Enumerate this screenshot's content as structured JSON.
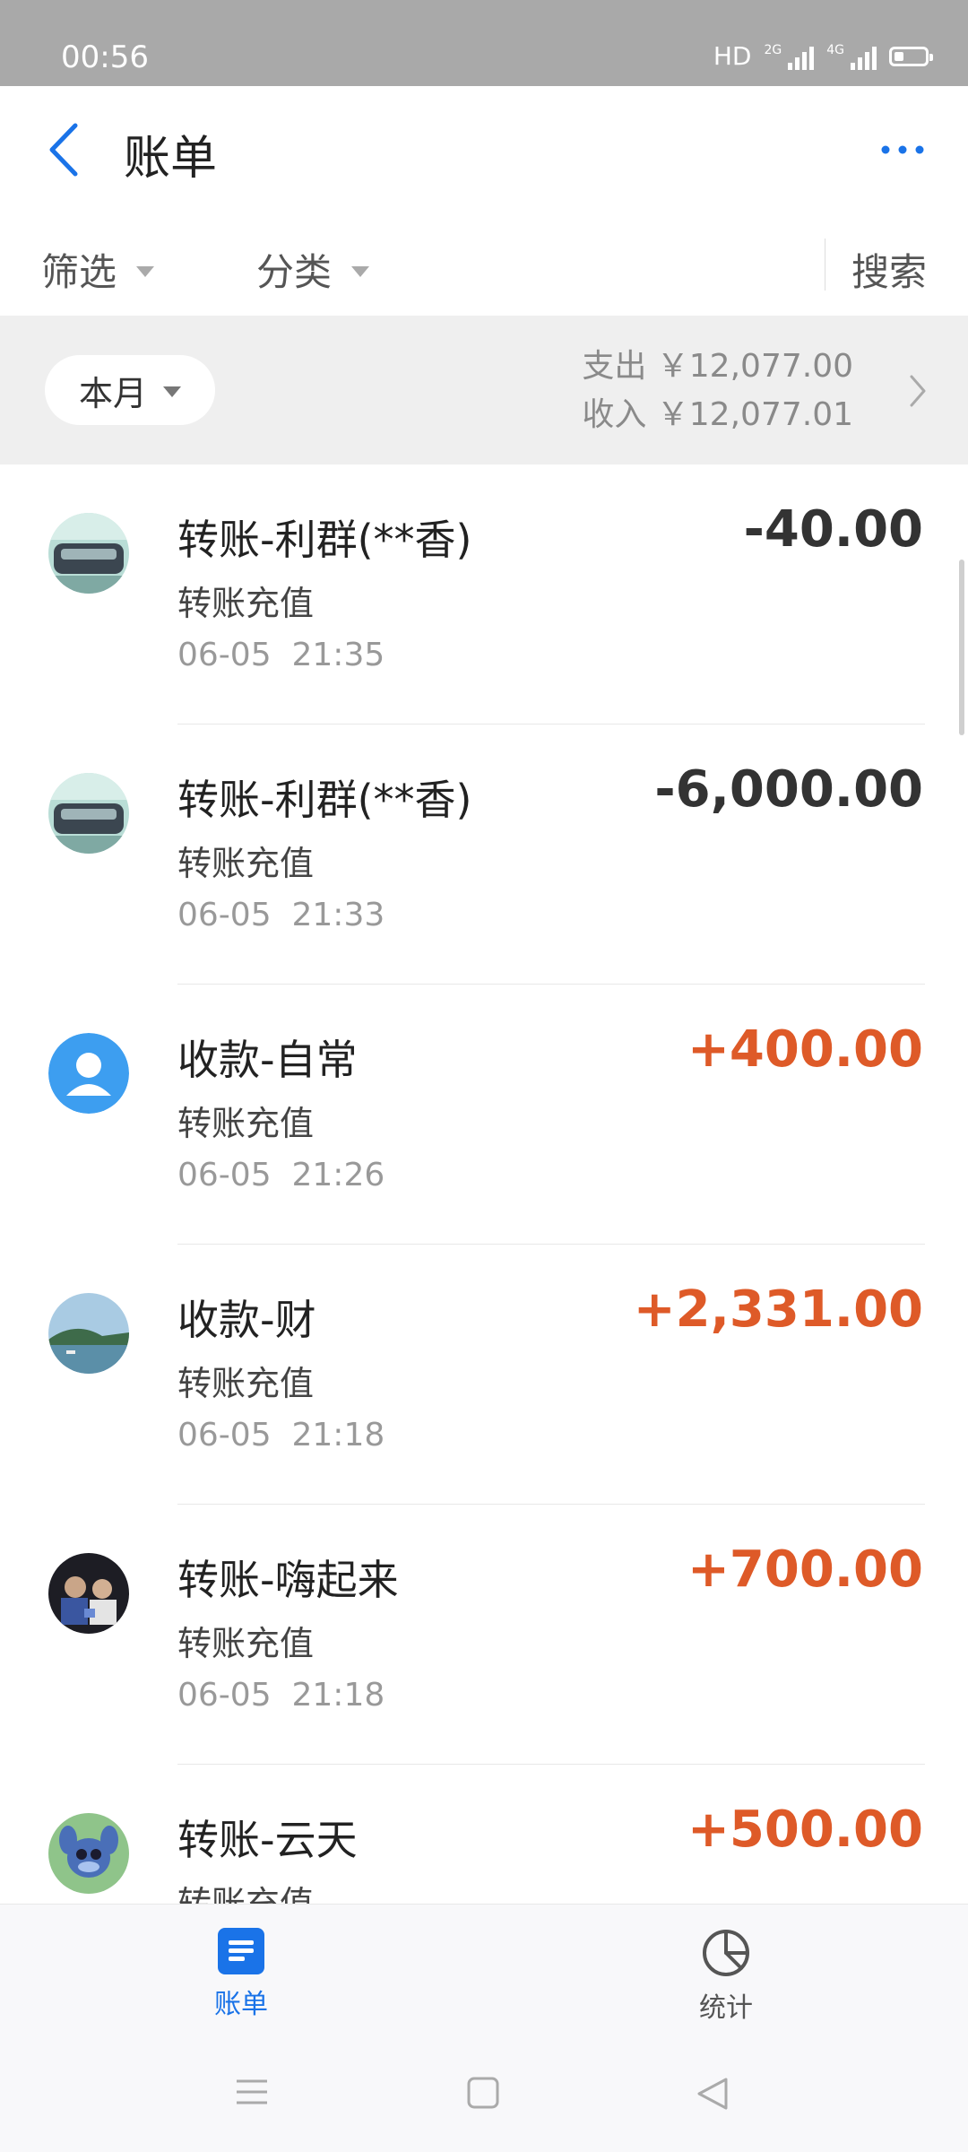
{
  "status_bar": {
    "time": "00:56",
    "network": "HD",
    "sig1": "2G",
    "sig2": "4G"
  },
  "header": {
    "title": "账单"
  },
  "filters": {
    "filter_label": "筛选",
    "category_label": "分类",
    "search_label": "搜索"
  },
  "summary": {
    "month": "本月",
    "expense_label": "支出",
    "expense_value": "￥12,077.00",
    "income_label": "收入",
    "income_value": "￥12,077.01"
  },
  "transactions": [
    {
      "name": "转账-利群(**香)",
      "sub": "转账充值",
      "date": "06-05",
      "time": "21:35",
      "amount": "-40.00",
      "type": "expense",
      "avatar": "photo-car"
    },
    {
      "name": "转账-利群(**香)",
      "sub": "转账充值",
      "date": "06-05",
      "time": "21:33",
      "amount": "-6,000.00",
      "type": "expense",
      "avatar": "photo-car"
    },
    {
      "name": "收款-自常",
      "sub": "转账充值",
      "date": "06-05",
      "time": "21:26",
      "amount": "+400.00",
      "type": "income",
      "avatar": "default-user"
    },
    {
      "name": "收款-财",
      "sub": "转账充值",
      "date": "06-05",
      "time": "21:18",
      "amount": "+2,331.00",
      "type": "income",
      "avatar": "photo-sea"
    },
    {
      "name": "转账-嗨起来",
      "sub": "转账充值",
      "date": "06-05",
      "time": "21:18",
      "amount": "+700.00",
      "type": "income",
      "avatar": "photo-people"
    },
    {
      "name": "转账-云天",
      "sub": "转账充值",
      "date": "",
      "time": "",
      "amount": "+500.00",
      "type": "income",
      "avatar": "photo-cartoon"
    }
  ],
  "tabs": {
    "bill": "账单",
    "stats": "统计"
  },
  "colors": {
    "accent": "#1a73e8",
    "income": "#de5a28",
    "expense": "#333333"
  }
}
